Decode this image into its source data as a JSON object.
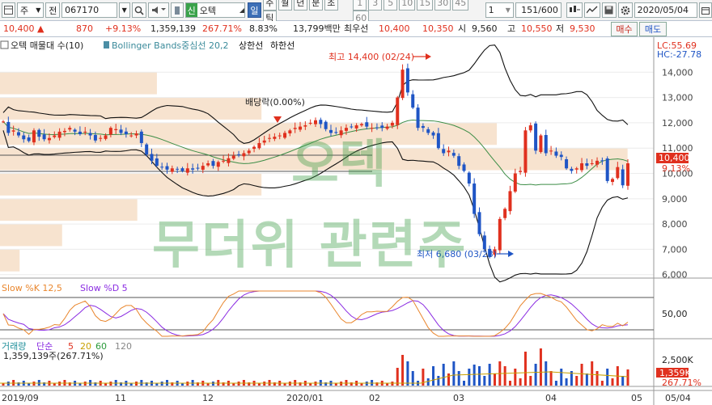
{
  "toolbar": {
    "market": "주",
    "prefix": "전",
    "code": "067170",
    "badge": "신",
    "name": "오텍",
    "period_active": "일",
    "periods": [
      "주",
      "월",
      "년",
      "분",
      "초",
      "틱"
    ],
    "intervals": [
      "1",
      "3",
      "5",
      "10",
      "15",
      "30",
      "45",
      "60"
    ],
    "unit": "1",
    "count": "151/600",
    "date": "2020/05/04"
  },
  "quote": {
    "price": "10,400",
    "change": "870",
    "change_pct": "+9.13%",
    "volume": "1,359,139",
    "volume_pct": "267.71%",
    "turnover": "8.83%",
    "amount": "13,799백만",
    "best_label": "최우선",
    "best_ask": "10,400",
    "best_bid": "10,350",
    "open_label": "시",
    "open": "9,560",
    "high_label": "고",
    "high": "10,550",
    "low_label": "저",
    "low": "9,530",
    "buy": "매수",
    "sell": "매도"
  },
  "price_panel": {
    "title": "오텍 매물대 수(10)",
    "bb_label": "Bollinger Bands중심선 20,2",
    "upper_label": "상한선",
    "lower_label": "하한선",
    "lc": "LC:55.69",
    "hc": "HC:-27.78",
    "y_ticks": [
      "14,000",
      "13,000",
      "12,000",
      "11,000",
      "10,000",
      "9,000",
      "8,000",
      "7,000",
      "6,000"
    ],
    "last_price": "10,400",
    "last_pct": "9.13%",
    "high_note": "최고 14,400 (02/24)",
    "low_note": "최저 6,680 (03/23)",
    "dividend_note": "배당락(0.00%)",
    "watermark1": "오텍",
    "watermark2": "무더위 관련주"
  },
  "stoch_panel": {
    "k_label": "Slow %K 12,5",
    "d_label": "Slow %D 5",
    "y_tick": "50,00"
  },
  "volume_panel": {
    "title": "거래량",
    "ma_label": "단순",
    "ma": [
      "5",
      "20",
      "60",
      "120"
    ],
    "value": "1,359,139주(267.71%)",
    "y_tick": "2,500K",
    "last": "1,359K",
    "last_pct": "267.71%"
  },
  "x_labels": [
    "2019/09",
    "11",
    "12",
    "2020/01",
    "02",
    "03",
    "04",
    "05",
    "05/04"
  ],
  "colors": {
    "up": "#e0301e",
    "down": "#1f55c5",
    "bb": "#111111",
    "mid": "#3c8d46",
    "k": "#e9862d",
    "d": "#8a2be2",
    "profile": "#f7e3cf",
    "accent": "#3d6fb7"
  },
  "chart_data": {
    "type": "candlestick",
    "title": "오텍",
    "ylim": [
      5800,
      15000
    ],
    "close": [
      12050,
      11600,
      11700,
      11500,
      11350,
      11280,
      11700,
      11450,
      11350,
      11400,
      11500,
      11650,
      11680,
      11800,
      11650,
      11550,
      11650,
      11500,
      11300,
      11400,
      11500,
      11800,
      11750,
      11600,
      11550,
      11500,
      11580,
      11200,
      10750,
      10500,
      10300,
      10250,
      10150,
      10200,
      10150,
      10100,
      10200,
      10150,
      10200,
      10300,
      10400,
      10300,
      10450,
      10500,
      10600,
      10700,
      10750,
      10800,
      10900,
      11050,
      11200,
      11300,
      11400,
      11450,
      11500,
      11600,
      11700,
      11800,
      11850,
      11900,
      12000,
      12100,
      11950,
      11750,
      11600,
      11600,
      11700,
      11800,
      11850,
      11900,
      11950,
      11850,
      11800,
      11800,
      11800,
      11850,
      12000,
      13000,
      14100,
      13200,
      12600,
      11800,
      11800,
      11600,
      11500,
      11000,
      10800,
      10900,
      10700,
      10300,
      10100,
      9600,
      8400,
      7600,
      7000,
      6700,
      7000,
      8200,
      8600,
      9300,
      10000,
      10100,
      11700,
      11900,
      10900,
      11500,
      10800,
      10900,
      10700,
      10650,
      10200,
      10100,
      10200,
      10400,
      10300,
      10400,
      10500,
      10500,
      9700,
      9780,
      10250,
      9530,
      10400
    ],
    "series": [
      {
        "name": "Slow %K 12,5"
      },
      {
        "name": "Slow %D 5"
      }
    ]
  }
}
